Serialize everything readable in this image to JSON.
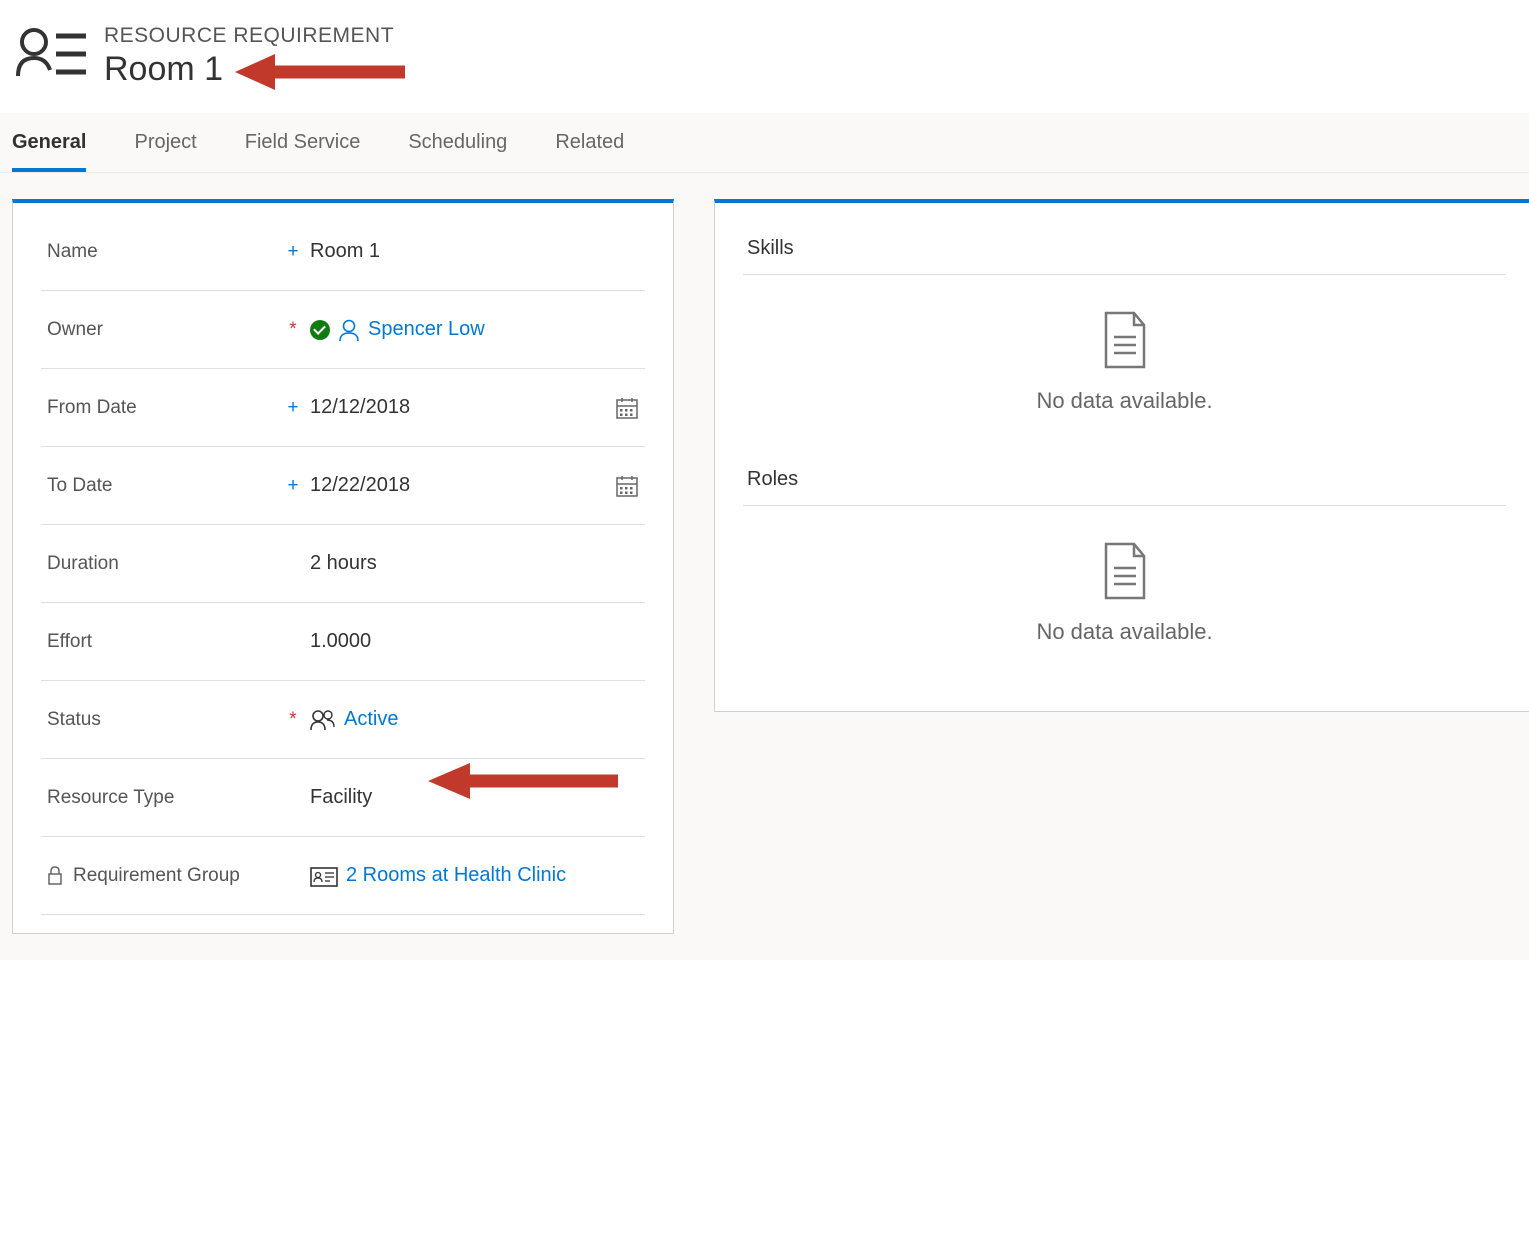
{
  "header": {
    "label": "RESOURCE REQUIREMENT",
    "title": "Room 1"
  },
  "tabs": [
    {
      "label": "General",
      "active": true
    },
    {
      "label": "Project",
      "active": false
    },
    {
      "label": "Field Service",
      "active": false
    },
    {
      "label": "Scheduling",
      "active": false
    },
    {
      "label": "Related",
      "active": false
    }
  ],
  "form": {
    "name": {
      "label": "Name",
      "value": "Room 1",
      "marker": "+"
    },
    "owner": {
      "label": "Owner",
      "value": "Spencer Low",
      "marker": "*"
    },
    "fromDate": {
      "label": "From Date",
      "value": "12/12/2018",
      "marker": "+"
    },
    "toDate": {
      "label": "To Date",
      "value": "12/22/2018",
      "marker": "+"
    },
    "duration": {
      "label": "Duration",
      "value": "2 hours"
    },
    "effort": {
      "label": "Effort",
      "value": "1.0000"
    },
    "status": {
      "label": "Status",
      "value": "Active",
      "marker": "*"
    },
    "resourceType": {
      "label": "Resource Type",
      "value": "Facility"
    },
    "reqGroup": {
      "label": "Requirement Group",
      "value": "2 Rooms at Health Clinic"
    }
  },
  "sections": {
    "skills": {
      "title": "Skills",
      "empty": "No data available."
    },
    "roles": {
      "title": "Roles",
      "empty": "No data available."
    }
  }
}
